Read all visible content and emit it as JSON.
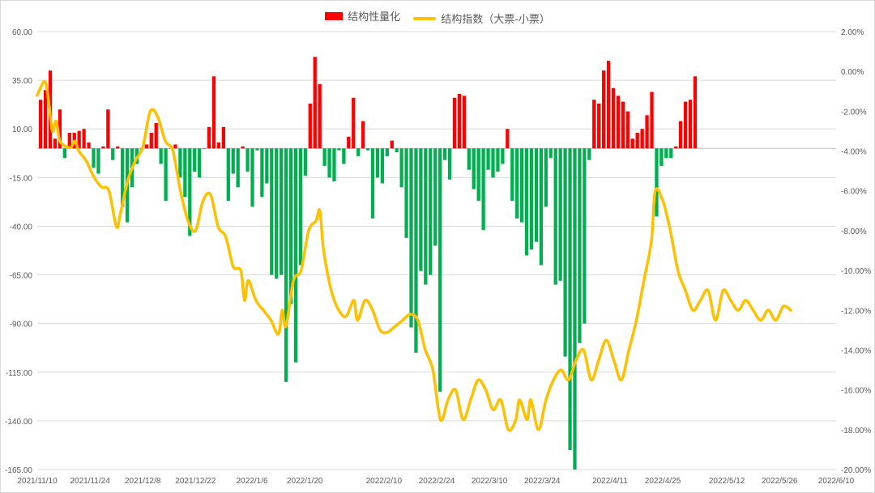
{
  "chart_data": {
    "type": "bar+line",
    "title": "",
    "xlabel": "",
    "ylabel_left": "",
    "ylabel_right": "",
    "legend_position": "top-center",
    "grid": true,
    "colors": {
      "positive": "#ff0000",
      "negative": "#00b050",
      "line": "#ffc000"
    },
    "ylim_left": [
      -165,
      60
    ],
    "left_ticks": [
      "60.00",
      "35.00",
      "10.00",
      "-15.00",
      "-40.00",
      "-65.00",
      "-90.00",
      "-115.00",
      "-140.00",
      "-165.00"
    ],
    "ylim_right": [
      -20,
      2
    ],
    "right_ticks": [
      "2.00%",
      "0.00%",
      "-2.00%",
      "-4.00%",
      "-6.00%",
      "-8.00%",
      "-10.00%",
      "-12.00%",
      "-14.00%",
      "-16.00%",
      "-18.00%",
      "-20.00%"
    ],
    "x_range": [
      "2021-11-10",
      "2022-06-10"
    ],
    "x_ticks": [
      "2021/11/10",
      "2021/11/24",
      "2021/12/8",
      "2021/12/22",
      "2022/1/6",
      "2022/1/20",
      "2022/2/10",
      "2022/2/24",
      "2022/3/10",
      "2022/3/24",
      "2022/4/11",
      "2022/4/25",
      "2022/5/12",
      "2022/5/26",
      "2022/6/10"
    ],
    "series": [
      {
        "name": "结构性量化",
        "type": "bar",
        "axis": "left",
        "start_date": "2021-11-10",
        "values": [
          25,
          30,
          40,
          5,
          20,
          -5,
          8,
          8,
          9,
          10,
          3,
          -10,
          -13,
          1,
          20,
          -6,
          1,
          -30,
          -38,
          -20,
          -8,
          -1,
          2,
          8,
          13,
          -8,
          -27,
          0,
          2,
          -15,
          -25,
          -45,
          -12,
          -15,
          0,
          11,
          37,
          3,
          11,
          -27,
          -13,
          -20,
          1,
          -12,
          -30,
          -1,
          -25,
          -18,
          -65,
          -67,
          -65,
          -120,
          -80,
          -110,
          -60,
          -14,
          23,
          47,
          33,
          -9,
          -15,
          -17,
          -1,
          -8,
          6,
          26,
          -4,
          14,
          -1,
          -36,
          -15,
          -18,
          -4,
          4,
          -2,
          -20,
          -46,
          -92,
          -105,
          -63,
          -70,
          -65,
          -50,
          -125,
          -6,
          -16,
          26,
          28,
          27,
          -11,
          -21,
          -27,
          -42,
          -11,
          -15,
          -12,
          -8,
          10,
          -27,
          -36,
          -38,
          -55,
          -52,
          -48,
          -60,
          -30,
          -5,
          -70,
          -68,
          -107,
          -155,
          -165,
          -100,
          -90,
          -6,
          25,
          23,
          40,
          45,
          31,
          27,
          24,
          19,
          5,
          8,
          10,
          17,
          29,
          -35,
          -9,
          -5,
          -5,
          1,
          14,
          24,
          25,
          37
        ]
      },
      {
        "name": "结构指数（大票-小票）",
        "type": "line",
        "axis": "right",
        "points": [
          [
            "2021-11-10",
            -1.2
          ],
          [
            "2021-11-12",
            -0.5
          ],
          [
            "2021-11-13",
            -1.5
          ],
          [
            "2021-11-14",
            -3.0
          ],
          [
            "2021-11-15",
            -2.5
          ],
          [
            "2021-11-16",
            -3.5
          ],
          [
            "2021-11-18",
            -3.8
          ],
          [
            "2021-11-19",
            -3.8
          ],
          [
            "2021-11-20",
            -3.5
          ],
          [
            "2021-11-21",
            -4.0
          ],
          [
            "2021-11-23",
            -4.5
          ],
          [
            "2021-11-25",
            -5.3
          ],
          [
            "2021-11-27",
            -5.8
          ],
          [
            "2021-11-29",
            -6.0
          ],
          [
            "2021-12-01",
            -7.8
          ],
          [
            "2021-12-02",
            -7.2
          ],
          [
            "2021-12-04",
            -5.5
          ],
          [
            "2021-12-06",
            -4.5
          ],
          [
            "2021-12-08",
            -3.8
          ],
          [
            "2021-12-10",
            -2.0
          ],
          [
            "2021-12-12",
            -2.3
          ],
          [
            "2021-12-14",
            -3.5
          ],
          [
            "2021-12-16",
            -4.0
          ],
          [
            "2021-12-18",
            -6.0
          ],
          [
            "2021-12-20",
            -7.5
          ],
          [
            "2021-12-22",
            -8.0
          ],
          [
            "2021-12-24",
            -6.5
          ],
          [
            "2021-12-26",
            -6.2
          ],
          [
            "2021-12-28",
            -7.8
          ],
          [
            "2021-12-30",
            -8.3
          ],
          [
            "2022-01-01",
            -9.8
          ],
          [
            "2022-01-03",
            -10.0
          ],
          [
            "2022-01-04",
            -11.5
          ],
          [
            "2022-01-05",
            -10.5
          ],
          [
            "2022-01-07",
            -11.5
          ],
          [
            "2022-01-09",
            -12.0
          ],
          [
            "2022-01-11",
            -12.5
          ],
          [
            "2022-01-13",
            -13.2
          ],
          [
            "2022-01-14",
            -12.0
          ],
          [
            "2022-01-15",
            -12.8
          ],
          [
            "2022-01-17",
            -10.5
          ],
          [
            "2022-01-19",
            -10.0
          ],
          [
            "2022-01-21",
            -8.0
          ],
          [
            "2022-01-23",
            -7.5
          ],
          [
            "2022-01-24",
            -7.0
          ],
          [
            "2022-01-25",
            -9.0
          ],
          [
            "2022-01-27",
            -11.0
          ],
          [
            "2022-01-29",
            -12.0
          ],
          [
            "2022-01-31",
            -12.3
          ],
          [
            "2022-02-02",
            -11.5
          ],
          [
            "2022-02-03",
            -12.5
          ],
          [
            "2022-02-05",
            -11.5
          ],
          [
            "2022-02-07",
            -12.0
          ],
          [
            "2022-02-09",
            -13.0
          ],
          [
            "2022-02-11",
            -13.1
          ],
          [
            "2022-02-13",
            -12.8
          ],
          [
            "2022-02-15",
            -12.5
          ],
          [
            "2022-02-17",
            -12.2
          ],
          [
            "2022-02-19",
            -12.5
          ],
          [
            "2022-02-21",
            -14.0
          ],
          [
            "2022-02-23",
            -15.0
          ],
          [
            "2022-02-25",
            -17.5
          ],
          [
            "2022-02-27",
            -16.5
          ],
          [
            "2022-03-01",
            -16.0
          ],
          [
            "2022-03-03",
            -17.5
          ],
          [
            "2022-03-05",
            -16.5
          ],
          [
            "2022-03-07",
            -15.5
          ],
          [
            "2022-03-09",
            -16.0
          ],
          [
            "2022-03-11",
            -17.0
          ],
          [
            "2022-03-13",
            -16.5
          ],
          [
            "2022-03-15",
            -18.0
          ],
          [
            "2022-03-17",
            -17.5
          ],
          [
            "2022-03-18",
            -16.5
          ],
          [
            "2022-03-20",
            -17.5
          ],
          [
            "2022-03-21",
            -16.5
          ],
          [
            "2022-03-23",
            -18.0
          ],
          [
            "2022-03-25",
            -16.5
          ],
          [
            "2022-03-27",
            -15.5
          ],
          [
            "2022-03-29",
            -15.0
          ],
          [
            "2022-03-31",
            -15.5
          ],
          [
            "2022-04-02",
            -14.5
          ],
          [
            "2022-04-04",
            -14.0
          ],
          [
            "2022-04-06",
            -15.5
          ],
          [
            "2022-04-08",
            -14.5
          ],
          [
            "2022-04-10",
            -13.5
          ],
          [
            "2022-04-12",
            -14.5
          ],
          [
            "2022-04-14",
            -15.5
          ],
          [
            "2022-04-16",
            -14.0
          ],
          [
            "2022-04-18",
            -12.5
          ],
          [
            "2022-04-20",
            -10.5
          ],
          [
            "2022-04-22",
            -8.5
          ],
          [
            "2022-04-23",
            -6.0
          ],
          [
            "2022-04-25",
            -6.5
          ],
          [
            "2022-04-27",
            -8.0
          ],
          [
            "2022-04-29",
            -10.0
          ],
          [
            "2022-05-01",
            -11.0
          ],
          [
            "2022-05-03",
            -12.0
          ],
          [
            "2022-05-05",
            -11.5
          ],
          [
            "2022-05-07",
            -11.0
          ],
          [
            "2022-05-09",
            -12.5
          ],
          [
            "2022-05-11",
            -11.0
          ],
          [
            "2022-05-13",
            -11.5
          ],
          [
            "2022-05-15",
            -12.0
          ],
          [
            "2022-05-17",
            -11.5
          ],
          [
            "2022-05-19",
            -12.0
          ],
          [
            "2022-05-21",
            -12.5
          ],
          [
            "2022-05-23",
            -12.0
          ],
          [
            "2022-05-25",
            -12.5
          ],
          [
            "2022-05-27",
            -11.8
          ],
          [
            "2022-05-29",
            -12.0
          ]
        ]
      }
    ]
  }
}
